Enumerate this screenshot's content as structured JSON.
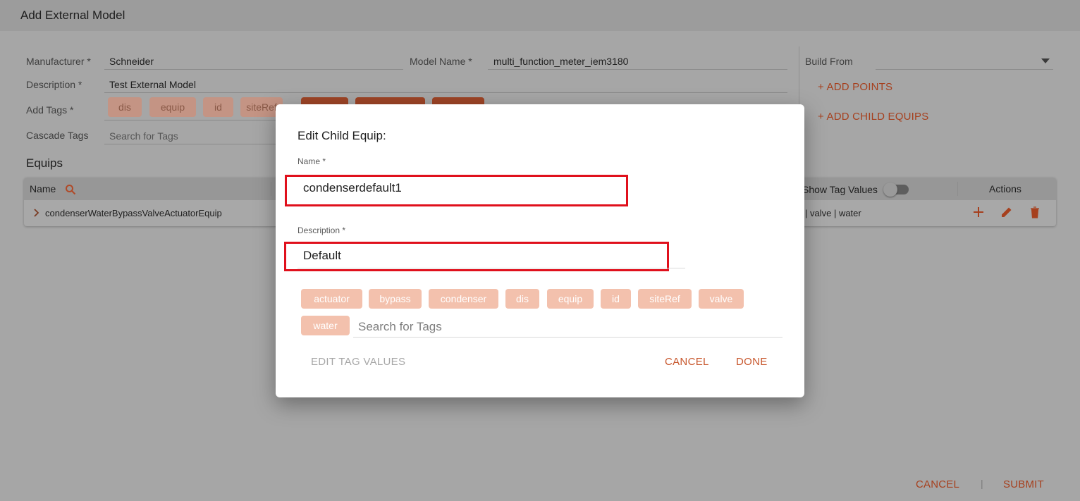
{
  "header": {
    "title": "Add External Model"
  },
  "form": {
    "manufacturer_label": "Manufacturer *",
    "manufacturer_value": "Schneider",
    "model_name_label": "Model Name *",
    "model_name_value": "multi_function_meter_iem3180",
    "description_label": "Description *",
    "description_value": "Test External Model",
    "add_tags_label": "Add Tags *",
    "add_tags": [
      "dis",
      "equip",
      "id",
      "siteRef"
    ],
    "cascade_tags_label": "Cascade Tags",
    "cascade_tags_placeholder": "Search for Tags",
    "build_from_label": "Build From",
    "add_points": "+ ADD POINTS",
    "add_child_equips": "+ ADD CHILD EQUIPS"
  },
  "equips": {
    "title": "Equips",
    "col_name": "Name",
    "col_show_tag_values": "Show Tag Values",
    "col_actions": "Actions",
    "row_name": "condenserWaterBypassValveActuatorEquip",
    "row_tags": "| valve | water"
  },
  "footer": {
    "cancel": "CANCEL",
    "separator": "|",
    "submit": "SUBMIT"
  },
  "modal": {
    "title": "Edit Child Equip:",
    "name_label": "Name *",
    "name_value": "condenserdefault1",
    "description_label": "Description *",
    "description_value": "Default",
    "tags": [
      "actuator",
      "bypass",
      "condenser",
      "dis",
      "equip",
      "id",
      "siteRef",
      "valve",
      "water"
    ],
    "search_placeholder": "Search for Tags",
    "edit_tag_values": "EDIT TAG VALUES",
    "cancel": "CANCEL",
    "done": "DONE"
  },
  "colors": {
    "accent": "#c8582e",
    "highlight": "#e0101c",
    "tag_chip": "#f3c1ad"
  }
}
